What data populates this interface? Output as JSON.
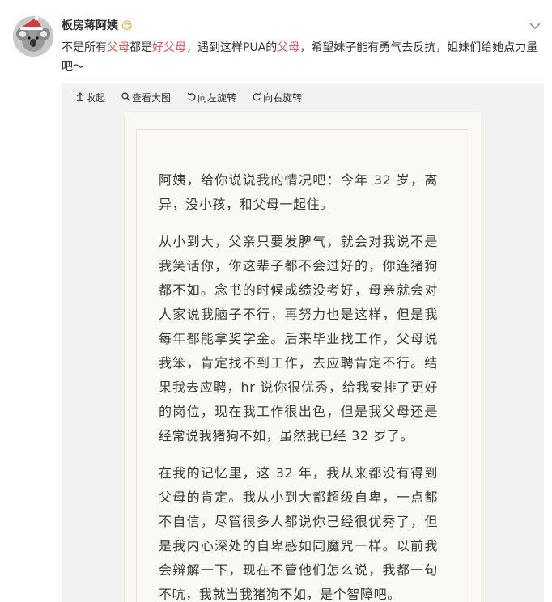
{
  "post": {
    "author": "板房蒋阿姨",
    "author_emoji": "😍",
    "text_parts": [
      {
        "text": "不是所有",
        "tag": false
      },
      {
        "text": "父母",
        "tag": true
      },
      {
        "text": "都是",
        "tag": false
      },
      {
        "text": "好父母",
        "tag": true
      },
      {
        "text": "，遇到这样PUA的",
        "tag": false
      },
      {
        "text": "父母",
        "tag": true
      },
      {
        "text": "，希望妹子能有勇气去反抗，姐妹们给她点力量吧～",
        "tag": false
      }
    ]
  },
  "toolbar": {
    "collapse": "收起",
    "view_large": "查看大图",
    "rotate_left": "向左旋转",
    "rotate_right": "向右旋转"
  },
  "image_text": {
    "p1": "阿姨，给你说说我的情况吧：今年 32 岁，离异，没小孩，和父母一起住。",
    "p2": "从小到大，父亲只要发脾气，就会对我说不是我笑话你，你这辈子都不会过好的，你连猪狗都不如。念书的时候成绩没考好，母亲就会对人家说我脑子不行，再努力也是这样，但是我每年都能拿奖学金。后来毕业找工作，父母说我笨，肯定找不到工作，去应聘肯定不行。结果我去应聘，hr 说你很优秀，给我安排了更好的岗位，现在我工作很出色，但是我父母还是经常说我猪狗不如，虽然我已经 32 岁了。",
    "p3": "在我的记忆里，这 32 年，我从来都没有得到父母的肯定。我从小到大都超级自卑，一点都不自信，尽管很多人都说你已经很优秀了，但是我内心深处的自卑感如同魔咒一样。以前我会辩解一下，现在不管他们怎么说，我都一句不吭，我就当我猪狗不如，是个智障吧。"
  }
}
